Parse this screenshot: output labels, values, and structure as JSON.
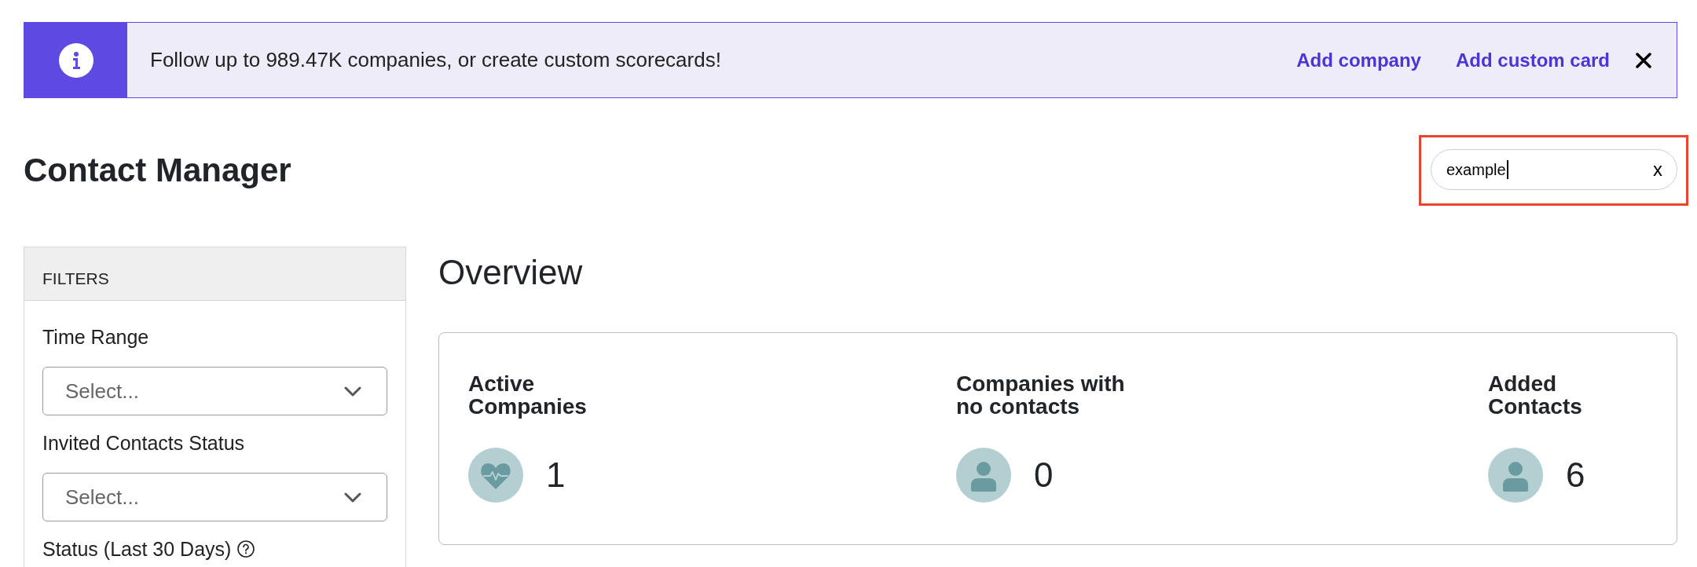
{
  "banner": {
    "message": "Follow up to 989.47K companies, or create custom scorecards!",
    "links": [
      "Add company",
      "Add custom card"
    ]
  },
  "header": {
    "title": "Contact Manager",
    "search": {
      "value": "example",
      "clear": "x",
      "highlighted": true
    }
  },
  "filters": {
    "title": "FILTERS",
    "fields": [
      {
        "kind": "select",
        "label": "Time Range",
        "placeholder": "Select...",
        "help": false
      },
      {
        "kind": "select",
        "label": "Invited Contacts Status",
        "placeholder": "Select...",
        "help": false
      },
      {
        "kind": "label",
        "label": "Status (Last 30 Days)",
        "help": true
      }
    ]
  },
  "overview": {
    "title": "Overview",
    "stats": [
      {
        "kind": "activity",
        "label": "Active\nCompanies",
        "value": "1"
      },
      {
        "kind": "person",
        "label": "Companies with\nno contacts",
        "value": "0"
      },
      {
        "kind": "person",
        "label": "Added\nContacts",
        "value": "6"
      }
    ]
  }
}
